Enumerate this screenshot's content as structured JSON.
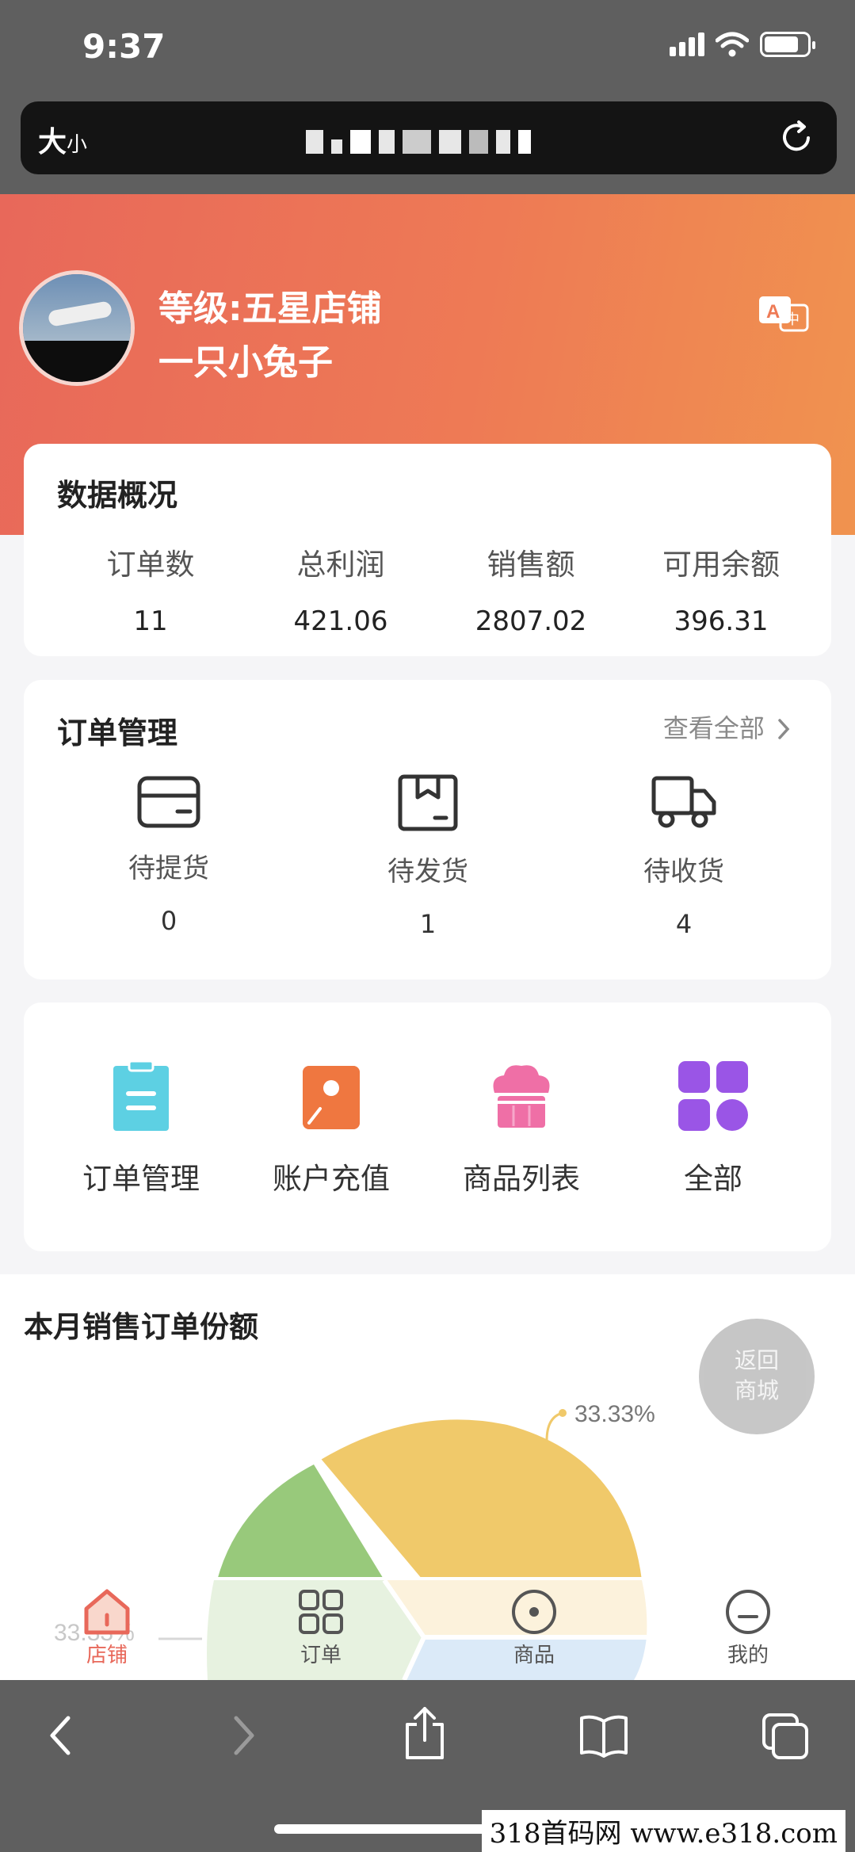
{
  "status": {
    "time": "9:37"
  },
  "browser": {
    "text_size_label": "大",
    "text_size_small": "小"
  },
  "profile": {
    "level": "等级:五星店铺",
    "name": "一只小兔子"
  },
  "overview": {
    "title": "数据概况",
    "items": [
      {
        "label": "订单数",
        "value": "11"
      },
      {
        "label": "总利润",
        "value": "421.06"
      },
      {
        "label": "销售额",
        "value": "2807.02"
      },
      {
        "label": "可用余额",
        "value": "396.31"
      }
    ]
  },
  "orders": {
    "title": "订单管理",
    "view_all": "查看全部",
    "items": [
      {
        "label": "待提货",
        "value": "0",
        "icon": "wallet-icon"
      },
      {
        "label": "待发货",
        "value": "1",
        "icon": "box-icon"
      },
      {
        "label": "待收货",
        "value": "4",
        "icon": "truck-icon"
      }
    ]
  },
  "menu": {
    "items": [
      {
        "label": "订单管理",
        "icon": "clipboard-icon",
        "color": "#5dd0e3"
      },
      {
        "label": "账户充值",
        "icon": "recharge-icon",
        "color": "#ee6b3b"
      },
      {
        "label": "商品列表",
        "icon": "cake-icon",
        "color": "#ef6fa6"
      },
      {
        "label": "全部",
        "icon": "grid-icon",
        "color": "#9a55e6"
      }
    ]
  },
  "chart": {
    "title": "本月销售订单份额",
    "labels": [
      "33.33%",
      "33.33%"
    ]
  },
  "chart_data": {
    "type": "pie",
    "title": "本月销售订单份额",
    "data_labels": [
      "33.33%",
      "33.33%"
    ],
    "slice_colors": [
      "#f0c96a",
      "#98c97b",
      "#b7d5f2"
    ]
  },
  "float_button": {
    "line1": "返回",
    "line2": "商城"
  },
  "tabs": [
    {
      "label": "店铺",
      "icon": "home-icon",
      "active": true
    },
    {
      "label": "订单",
      "icon": "apps-icon",
      "active": false
    },
    {
      "label": "商品",
      "icon": "product-icon",
      "active": false
    },
    {
      "label": "我的",
      "icon": "user-icon",
      "active": false
    }
  ],
  "watermark": "318首码网  www.e318.com",
  "colors": {
    "accent": "#e8685a",
    "gradient_end": "#f0934f",
    "gray_chrome": "#5f5f5f"
  }
}
